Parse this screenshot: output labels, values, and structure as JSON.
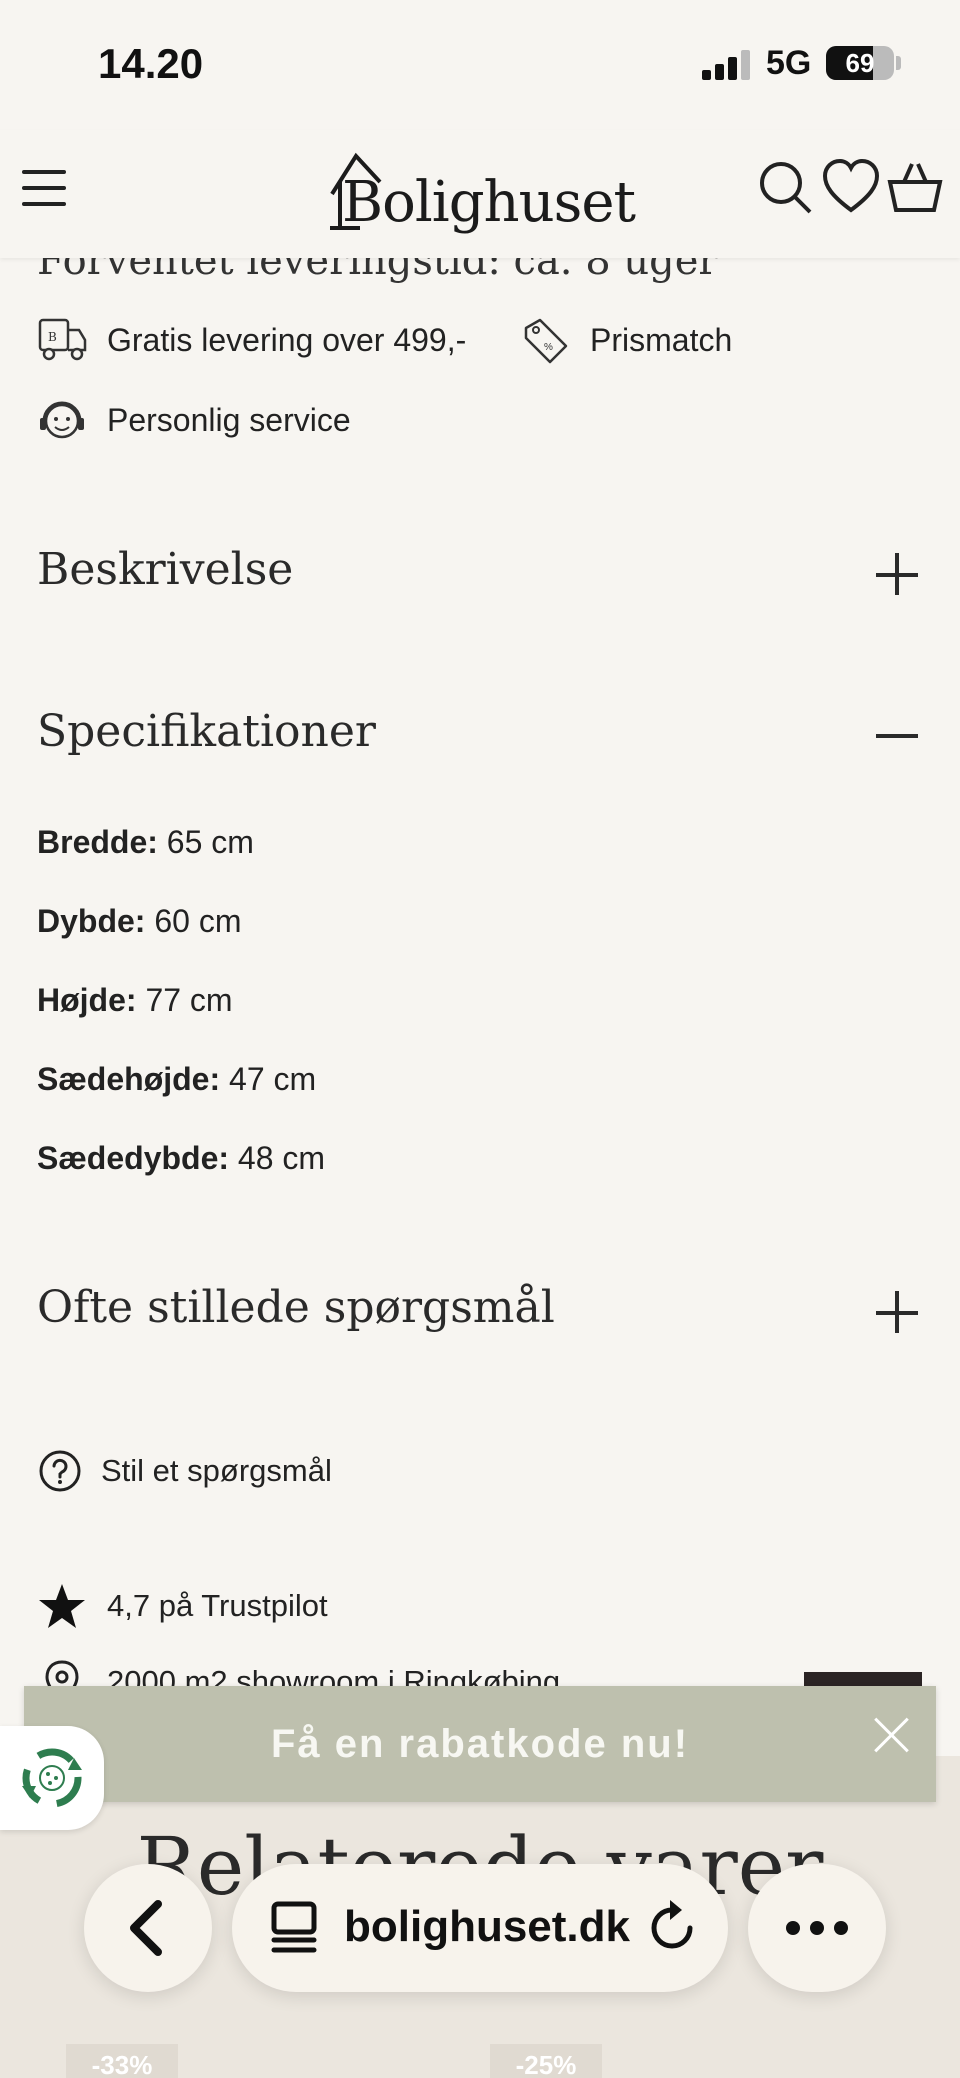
{
  "status_bar": {
    "time": "14.20",
    "network": "5G",
    "battery": "69",
    "battery_level": 0.69
  },
  "header": {
    "brand": "Bolighuset"
  },
  "product": {
    "delivery_partial": "Forventet leveringstid: ca.  8  uger",
    "features": [
      {
        "label": "Gratis levering over 499,-",
        "icon": "delivery-truck-icon"
      },
      {
        "label": "Prismatch",
        "icon": "price-tag-icon"
      },
      {
        "label": "Personlig service",
        "icon": "headset-icon"
      }
    ]
  },
  "accordions": {
    "description": {
      "title": "Beskrivelse",
      "state": "collapsed"
    },
    "specifications": {
      "title": "Specifikationer",
      "state": "expanded",
      "items": [
        {
          "label": "Bredde:",
          "value": " 65 cm"
        },
        {
          "label": "Dybde:",
          "value": " 60 cm"
        },
        {
          "label": "Højde:",
          "value": " 77 cm"
        },
        {
          "label": "Sædehøjde:",
          "value": " 47 cm"
        },
        {
          "label": "Sædedybde:",
          "value": " 48 cm"
        }
      ]
    },
    "faq": {
      "title": "Ofte stillede spørgsmål",
      "state": "collapsed"
    }
  },
  "ask_question": {
    "label": "Stil et spørgsmål"
  },
  "trust": {
    "trustpilot": "4,7 på Trustpilot",
    "showroom": "2000 m2 showroom i Ringkøbing"
  },
  "promo": {
    "text": "Få en rabatkode nu!"
  },
  "related": {
    "title": "Relaterede varer",
    "discounts": [
      "-33%",
      "-25%"
    ]
  },
  "browser": {
    "url": "bolighuset.dk"
  },
  "colors": {
    "background": "#f7f5f1",
    "promo": "#bec0ae",
    "recycle_green": "#2e7d4f",
    "dark": "#2b2424"
  }
}
